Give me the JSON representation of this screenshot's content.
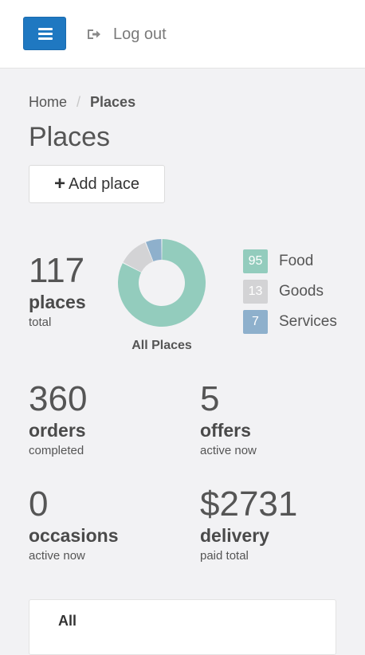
{
  "header": {
    "logout_label": "Log out"
  },
  "breadcrumb": {
    "home": "Home",
    "separator": "/",
    "current": "Places"
  },
  "page": {
    "title": "Places",
    "add_button_icon": "+",
    "add_button_label": "Add place"
  },
  "stats": {
    "places": {
      "value": "117",
      "label": "places",
      "sub": "total"
    },
    "orders": {
      "value": "360",
      "label": "orders",
      "sub": "completed"
    },
    "offers": {
      "value": "5",
      "label": "offers",
      "sub": "active now"
    },
    "occasions": {
      "value": "0",
      "label": "occasions",
      "sub": "active now"
    },
    "delivery": {
      "value": "$2731",
      "label": "delivery",
      "sub": "paid total"
    }
  },
  "chart_data": {
    "type": "pie",
    "title": "All Places",
    "categories": [
      "Food",
      "Goods",
      "Services"
    ],
    "values": [
      95,
      13,
      7
    ],
    "colors": [
      "#93ccbd",
      "#d3d3d5",
      "#8eb0cc"
    ]
  },
  "legend": [
    {
      "value": "95",
      "label": "Food",
      "color": "#93ccbd"
    },
    {
      "value": "13",
      "label": "Goods",
      "color": "#d3d3d5"
    },
    {
      "value": "7",
      "label": "Services",
      "color": "#8eb0cc"
    }
  ],
  "tabs": {
    "all_label": "All"
  },
  "icons": {
    "menu": "menu-icon",
    "logout": "logout-icon",
    "add": "plus-icon"
  }
}
